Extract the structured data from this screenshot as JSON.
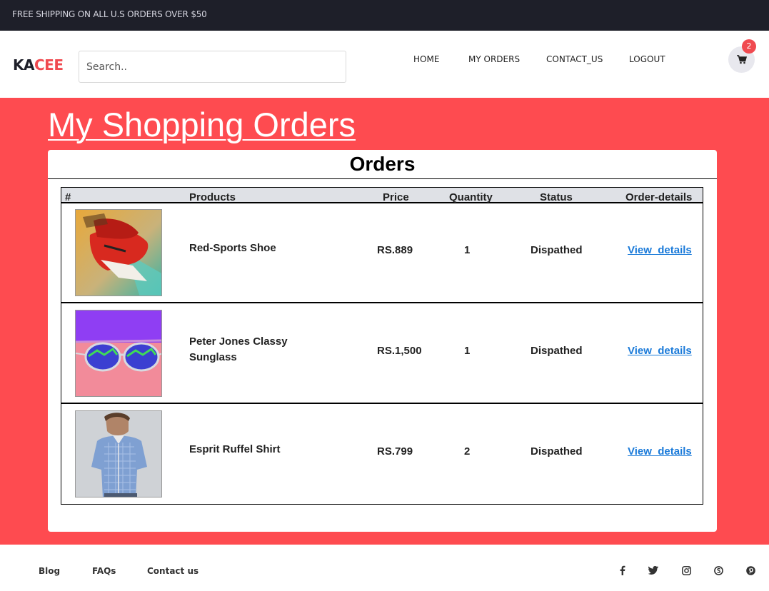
{
  "topbar": {
    "text": "FREE SHIPPING ON ALL U.S ORDERS OVER $50"
  },
  "header": {
    "logo_part1": "KA",
    "logo_part2": "CEE",
    "search_placeholder": "Search..",
    "nav": [
      "HOME",
      "MY ORDERS",
      "CONTACT_US",
      "LOGOUT"
    ],
    "cart_count": "2",
    "cart_icon": "shopping-cart-icon"
  },
  "page": {
    "title": "My Shopping Orders",
    "card_title": "Orders",
    "columns": [
      "#",
      "Products",
      "Price",
      "Quantity",
      "Status",
      "Order-details"
    ],
    "orders": [
      {
        "product": "Red-Sports Shoe",
        "price": "RS.889",
        "quantity": "1",
        "status": "Dispathed",
        "details": "View_details"
      },
      {
        "product": "Peter Jones Classy Sunglass",
        "price": "RS.1,500",
        "quantity": "1",
        "status": "Dispathed",
        "details": "View_details"
      },
      {
        "product": "Esprit Ruffel Shirt",
        "price": "RS.799",
        "quantity": "2",
        "status": "Dispathed",
        "details": "View_details"
      }
    ]
  },
  "footer": {
    "links": [
      "Blog",
      "FAQs",
      "Contact us"
    ],
    "social_icons": [
      "facebook-icon",
      "twitter-icon",
      "instagram-icon",
      "skype-icon",
      "pinterest-icon"
    ]
  },
  "colors": {
    "accent": "#fe4b50",
    "topbar": "#1e1f29",
    "link": "#1a7ad9"
  }
}
